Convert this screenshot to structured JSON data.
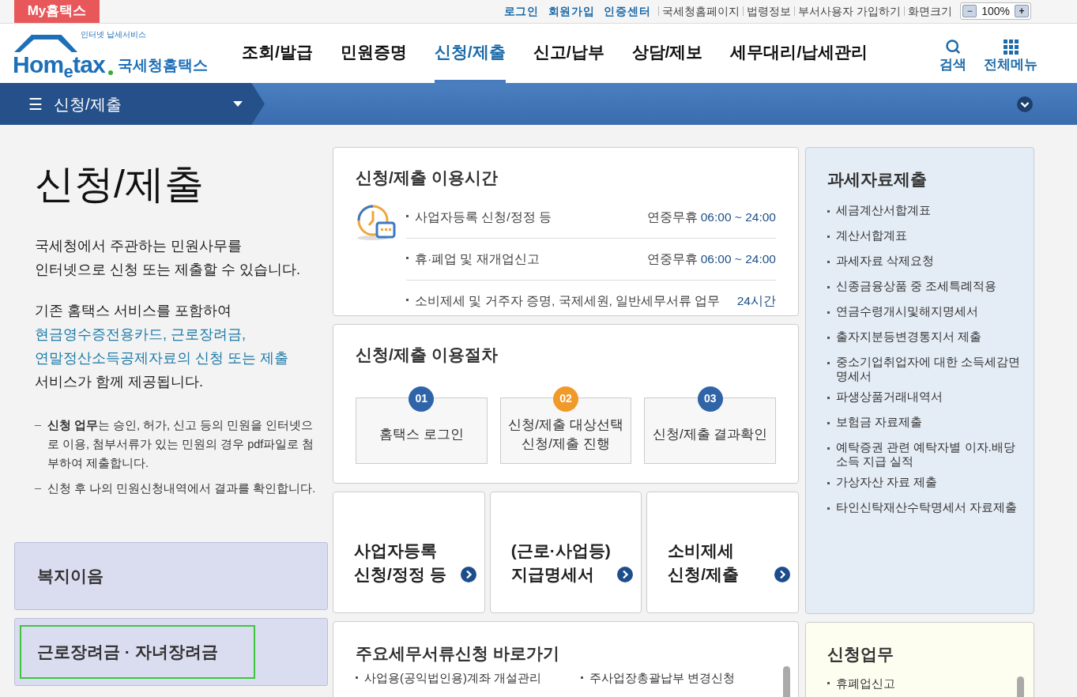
{
  "top_bar": {
    "my_tab": "My홈택스",
    "links": [
      {
        "label": "로그인",
        "kind": "primary"
      },
      {
        "label": "회원가입",
        "kind": "primary"
      },
      {
        "label": "인증센터",
        "kind": "primary"
      },
      {
        "label": "국세청홈페이지",
        "kind": "plain"
      },
      {
        "label": "법령정보",
        "kind": "plain"
      },
      {
        "label": "부서사용자 가입하기",
        "kind": "plain"
      }
    ],
    "zoom": {
      "label": "화면크기",
      "minus": "−",
      "value": "100%",
      "plus": "+"
    }
  },
  "header": {
    "logo": {
      "tagline": "인터넷 납세서비스",
      "wordmark_left": "Hom",
      "wordmark_e": "e",
      "wordmark_right": "tax",
      "name": "국세청홈택스"
    },
    "nav": [
      {
        "label": "조회/발급",
        "selected": false
      },
      {
        "label": "민원증명",
        "selected": false
      },
      {
        "label": "신청/제출",
        "selected": true
      },
      {
        "label": "신고/납부",
        "selected": false
      },
      {
        "label": "상담/제보",
        "selected": false
      },
      {
        "label": "세무대리/납세관리",
        "selected": false
      }
    ],
    "search": "검색",
    "all_menu": "전체메뉴"
  },
  "breadcrumb": {
    "menu_icon": "☰",
    "label": "신청/제출"
  },
  "intro": {
    "title": "신청/제출",
    "paragraph": "국세청에서 주관하는 민원사무를\n인터넷으로 신청 또는 제출할 수 있습니다.",
    "lead": "기존 홈택스 서비스를 포함하여",
    "link": "현금영수증전용카드, 근로장려금,\n연말정산소득공제자료의 신청 또는 제출",
    "tail": "서비스가 함께 제공됩니다.",
    "notes": [
      "**신청 업무**는 승인, 허가, 신고 등의 민원을 인터넷으로 이용, 첨부서류가 있는 민원의 경우 pdf파일로 첨부하여 제출합니다.",
      "신청 후 나의 민원신청내역에서 결과를 확인합니다."
    ]
  },
  "side_cards": [
    {
      "label": "복지이음",
      "selected": false
    },
    {
      "label": "근로장려금 · 자녀장려금",
      "selected": true
    }
  ],
  "hours": {
    "title": "신청/제출 이용시간",
    "rows": [
      {
        "task": "사업자등록 신청/정정 등",
        "days": "연중무휴",
        "time": "06:00 ~ 24:00"
      },
      {
        "task": "휴·폐업 및 재개업신고",
        "days": "연중무휴",
        "time": "06:00 ~ 24:00"
      },
      {
        "task": "소비제세 및 거주자 증명, 국제세원, 일반세무서류 업무",
        "time": "24시간"
      }
    ]
  },
  "procedure": {
    "title": "신청/제출 이용절차",
    "steps": [
      {
        "number": "01",
        "label": "홈택스 로그인",
        "color": "#2f64a8"
      },
      {
        "number": "02",
        "label": "신청/제출 대상선택\n신청/제출 진행",
        "color": "#f09a2a"
      },
      {
        "number": "03",
        "label": "신청/제출 결과확인",
        "color": "#2f64a8"
      }
    ]
  },
  "shortcuts": [
    {
      "label": "사업자등록\n신청/정정 등"
    },
    {
      "label": "(근로·사업등)\n지급명세서"
    },
    {
      "label": "소비제세\n신청/제출"
    }
  ],
  "documents": {
    "title": "주요세무서류신청 바로가기",
    "items": [
      "사업용(공익법인용)계좌 개설관리",
      "주사업장총괄납부 변경신청"
    ]
  },
  "tax_data": {
    "title": "과세자료제출",
    "items": [
      "세금계산서합계표",
      "계산서합계표",
      "과세자료 삭제요청",
      "신종금융상품 중 조세특례적용",
      "연금수령개시및해지명세서",
      "출자지분등변경통지서 제출",
      "중소기업취업자에 대한 소득세감면명세서",
      "파생상품거래내역서",
      "보험금 자료제출",
      "예탁증권 관련 예탁자별 이자.배당소득 지급 실적",
      "가상자산 자료 제출",
      "타인신탁재산수탁명세서 자료제출"
    ]
  },
  "applications": {
    "title": "신청업무",
    "items": [
      "휴폐업신고"
    ]
  }
}
